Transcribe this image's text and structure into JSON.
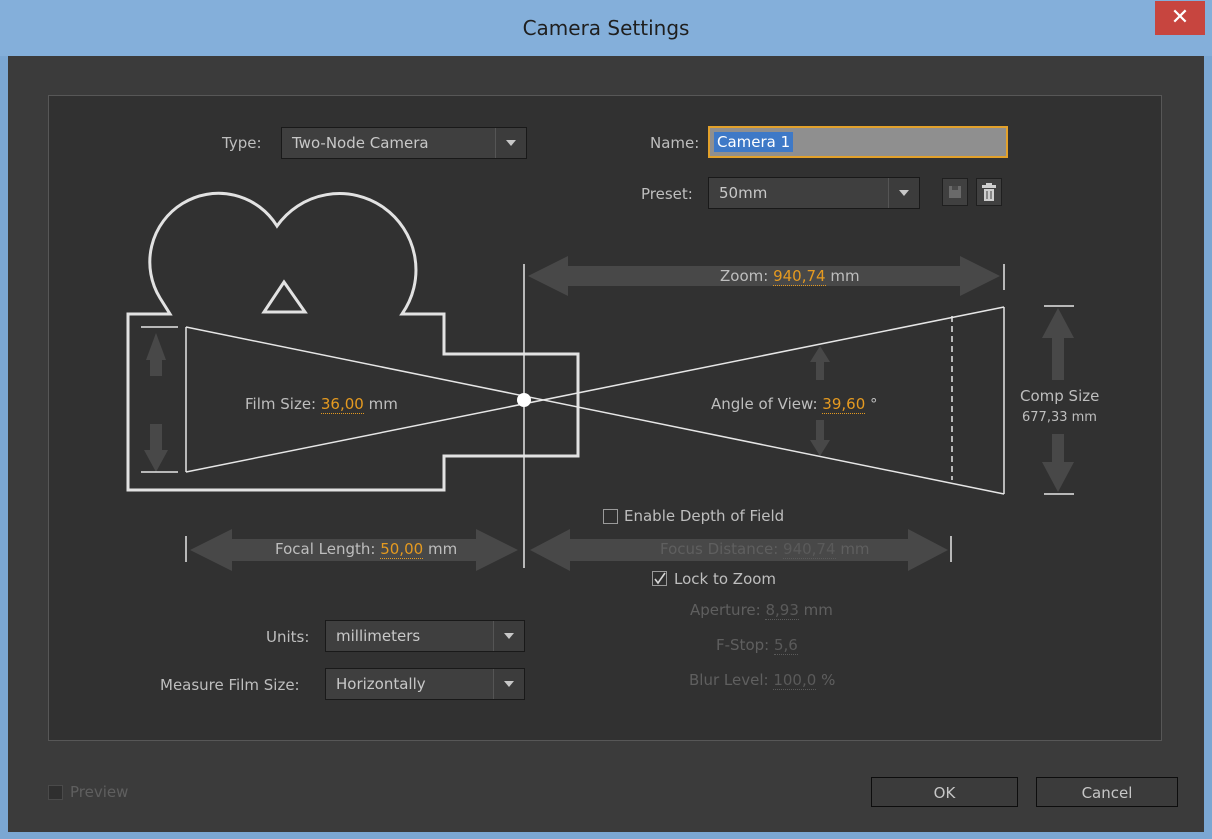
{
  "window": {
    "title": "Camera Settings",
    "close_glyph": "✕"
  },
  "type": {
    "label": "Type:",
    "value": "Two-Node Camera"
  },
  "name": {
    "label": "Name:",
    "value": "Camera 1"
  },
  "preset": {
    "label": "Preset:",
    "value": "50mm"
  },
  "zoom": {
    "label": "Zoom:",
    "value": "940,74",
    "unit": "mm"
  },
  "film_size": {
    "label": "Film Size:",
    "value": "36,00",
    "unit": "mm"
  },
  "angle_of_view": {
    "label": "Angle of View:",
    "value": "39,60",
    "unit": "°"
  },
  "comp_size": {
    "label": "Comp Size",
    "value": "677,33 mm"
  },
  "focal_length": {
    "label": "Focal Length:",
    "value": "50,00",
    "unit": "mm"
  },
  "depth_of_field": {
    "label": "Enable Depth of Field",
    "checked": false
  },
  "focus_distance": {
    "label": "Focus Distance:",
    "value": "940,74",
    "unit": "mm"
  },
  "lock_to_zoom": {
    "label": "Lock to Zoom",
    "checked": true
  },
  "aperture": {
    "label": "Aperture:",
    "value": "8,93",
    "unit": "mm"
  },
  "fstop": {
    "label": "F-Stop:",
    "value": "5,6"
  },
  "blur_level": {
    "label": "Blur Level:",
    "value": "100,0",
    "unit": "%"
  },
  "units": {
    "label": "Units:",
    "value": "millimeters"
  },
  "measure_film_size": {
    "label": "Measure Film Size:",
    "value": "Horizontally"
  },
  "preview": {
    "label": "Preview",
    "checked": false
  },
  "buttons": {
    "ok": "OK",
    "cancel": "Cancel"
  },
  "colors": {
    "accent": "#e59a20",
    "background": "#313131",
    "selection": "#3e79c7"
  }
}
